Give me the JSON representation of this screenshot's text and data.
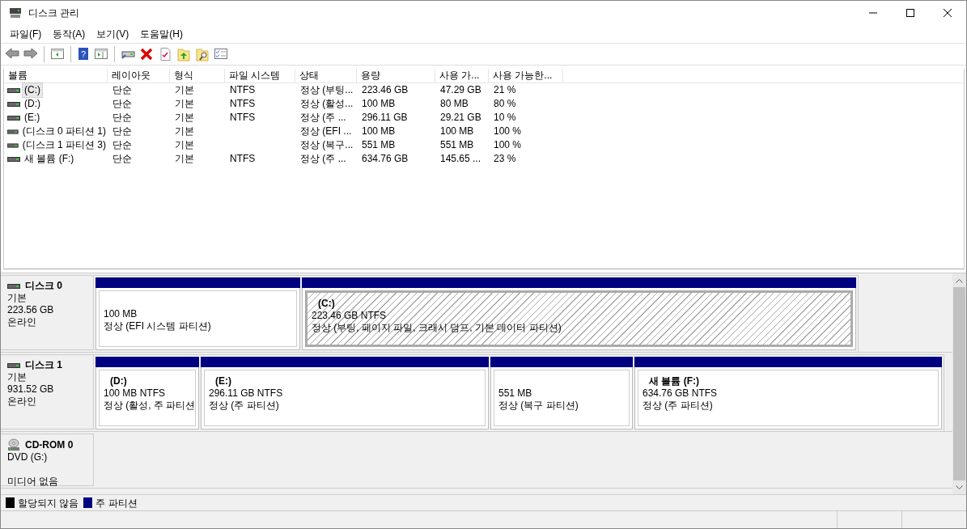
{
  "window": {
    "title": "디스크 관리"
  },
  "menu": [
    "파일(F)",
    "동작(A)",
    "보기(V)",
    "도움말(H)"
  ],
  "toolbar": {
    "help_glyph": "?"
  },
  "volume_table": {
    "columns": [
      "볼륨",
      "레이아웃",
      "형식",
      "파일 시스템",
      "상태",
      "용량",
      "사용 가...",
      "사용 가능한..."
    ],
    "rows": [
      {
        "cells": [
          "(C:)",
          "단순",
          "기본",
          "NTFS",
          "정상 (부팅...",
          "223.46 GB",
          "47.29 GB",
          "21 %"
        ],
        "selected": true
      },
      {
        "cells": [
          "(D:)",
          "단순",
          "기본",
          "NTFS",
          "정상 (활성...",
          "100 MB",
          "80 MB",
          "80 %"
        ],
        "selected": false
      },
      {
        "cells": [
          "(E:)",
          "단순",
          "기본",
          "NTFS",
          "정상 (주 ...",
          "296.11 GB",
          "29.21 GB",
          "10 %"
        ],
        "selected": false
      },
      {
        "cells": [
          "(디스크 0 파티션 1)",
          "단순",
          "기본",
          null,
          "정상 (EFI ...",
          "100 MB",
          "100 MB",
          "100 %"
        ],
        "selected": false
      },
      {
        "cells": [
          "(디스크 1 파티션 3)",
          "단순",
          "기본",
          null,
          "정상 (복구...",
          "551 MB",
          "551 MB",
          "100 %"
        ],
        "selected": false
      },
      {
        "cells": [
          "새 볼륨 (F:)",
          "단순",
          "기본",
          "NTFS",
          "정상 (주 ...",
          "634.76 GB",
          "145.65 ...",
          "23 %"
        ],
        "selected": false
      }
    ]
  },
  "disks": [
    {
      "kind": "disk",
      "name": "디스크 0",
      "type": "기본",
      "size": "223.56 GB",
      "status": "온라인",
      "partitions": [
        {
          "size": "100 MB",
          "status": "정상 (EFI 시스템 파티션)",
          "selected": false
        },
        {
          "title": "(C:)",
          "size": "223.46 GB NTFS",
          "status": "정상 (부팅, 페이지 파일, 크래시 덤프, 기본 데이터 파티션)",
          "selected": true
        }
      ]
    },
    {
      "kind": "disk",
      "name": "디스크 1",
      "type": "기본",
      "size": "931.52 GB",
      "status": "온라인",
      "partitions": [
        {
          "title": "(D:)",
          "size": "100 MB NTFS",
          "status": "정상 (활성, 주 파티션",
          "selected": false
        },
        {
          "title": "(E:)",
          "size": "296.11 GB NTFS",
          "status": "정상 (주 파티션)",
          "selected": false
        },
        {
          "size": "551 MB",
          "status": "정상 (복구 파티션)",
          "selected": false
        },
        {
          "title": "새 볼륨  (F:)",
          "size": "634.76 GB NTFS",
          "status": "정상 (주 파티션)",
          "selected": false
        }
      ]
    },
    {
      "kind": "cdrom",
      "name": "CD-ROM 0",
      "type": "DVD (G:)",
      "status": "미디어 없음"
    }
  ],
  "legend": [
    {
      "label": "할당되지 않음",
      "color": "#000000"
    },
    {
      "label": "주 파티션",
      "color": "#000080"
    }
  ]
}
